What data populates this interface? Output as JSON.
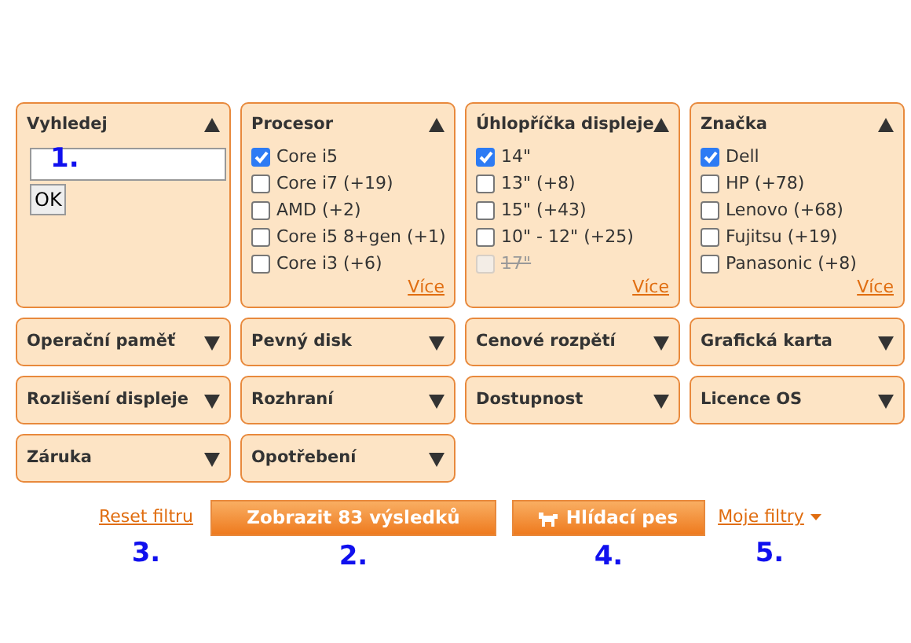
{
  "filters": [
    {
      "title": "Vyhledej",
      "kind": "search",
      "expanded": true,
      "button": "OK",
      "annotation": "1."
    },
    {
      "title": "Procesor",
      "kind": "checklist",
      "expanded": true,
      "more": "Více",
      "options": [
        {
          "label": "Core i5",
          "checked": true,
          "disabled": false
        },
        {
          "label": "Core i7 (+19)",
          "checked": false,
          "disabled": false
        },
        {
          "label": "AMD (+2)",
          "checked": false,
          "disabled": false
        },
        {
          "label": "Core i5 8+gen (+1)",
          "checked": false,
          "disabled": false
        },
        {
          "label": "Core i3 (+6)",
          "checked": false,
          "disabled": false
        }
      ]
    },
    {
      "title": "Úhlopříčka displeje",
      "kind": "checklist",
      "expanded": true,
      "more": "Více",
      "options": [
        {
          "label": "14\"",
          "checked": true,
          "disabled": false
        },
        {
          "label": "13\" (+8)",
          "checked": false,
          "disabled": false
        },
        {
          "label": "15\" (+43)",
          "checked": false,
          "disabled": false
        },
        {
          "label": "10\" - 12\" (+25)",
          "checked": false,
          "disabled": false
        },
        {
          "label": "17\"",
          "checked": false,
          "disabled": true
        }
      ]
    },
    {
      "title": "Značka",
      "kind": "checklist",
      "expanded": true,
      "more": "Více",
      "options": [
        {
          "label": "Dell",
          "checked": true,
          "disabled": false
        },
        {
          "label": "HP (+78)",
          "checked": false,
          "disabled": false
        },
        {
          "label": "Lenovo (+68)",
          "checked": false,
          "disabled": false
        },
        {
          "label": "Fujitsu (+19)",
          "checked": false,
          "disabled": false
        },
        {
          "label": "Panasonic (+8)",
          "checked": false,
          "disabled": false
        }
      ]
    },
    {
      "title": "Operační paměť",
      "expanded": false
    },
    {
      "title": "Pevný disk",
      "expanded": false
    },
    {
      "title": "Cenové rozpětí",
      "expanded": false
    },
    {
      "title": "Grafická karta",
      "expanded": false
    },
    {
      "title": "Rozlišení displeje",
      "expanded": false
    },
    {
      "title": "Rozhraní",
      "expanded": false
    },
    {
      "title": "Dostupnost",
      "expanded": false
    },
    {
      "title": "Licence OS",
      "expanded": false
    },
    {
      "title": "Záruka",
      "expanded": false
    },
    {
      "title": "Opotřebení",
      "expanded": false
    }
  ],
  "actions": [
    {
      "kind": "link",
      "label": "Reset filtru",
      "annotation": "3."
    },
    {
      "kind": "primary",
      "label": "Zobrazit 83 výsledků",
      "annotation": "2."
    },
    {
      "kind": "watch",
      "label": "Hlídací pes",
      "annotation": "4."
    },
    {
      "kind": "dropdown",
      "label": "Moje filtry",
      "annotation": "5."
    }
  ]
}
